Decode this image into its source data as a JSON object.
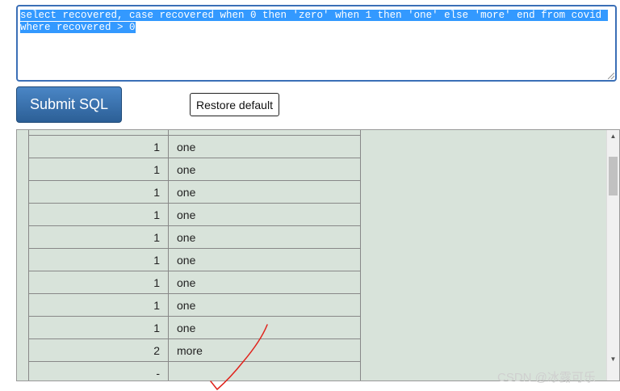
{
  "editor": {
    "sql": "select recovered, case recovered when 0 then 'zero' when 1 then 'one' else 'more' end from covid where recovered > 0"
  },
  "buttons": {
    "submit_label": "Submit SQL",
    "restore_label": "Restore default"
  },
  "results": {
    "rows": [
      {
        "recovered": "1",
        "label": "one"
      },
      {
        "recovered": "1",
        "label": "one"
      },
      {
        "recovered": "1",
        "label": "one"
      },
      {
        "recovered": "1",
        "label": "one"
      },
      {
        "recovered": "1",
        "label": "one"
      },
      {
        "recovered": "1",
        "label": "one"
      },
      {
        "recovered": "1",
        "label": "one"
      },
      {
        "recovered": "1",
        "label": "one"
      },
      {
        "recovered": "1",
        "label": "one"
      },
      {
        "recovered": "2",
        "label": "more"
      },
      {
        "recovered": "-",
        "label": ""
      }
    ]
  },
  "scrollbar": {
    "up_icon": "▲",
    "down_icon": "▼"
  },
  "watermark": "CSDN @冰露可乐",
  "annotation_color": "#e0231c"
}
